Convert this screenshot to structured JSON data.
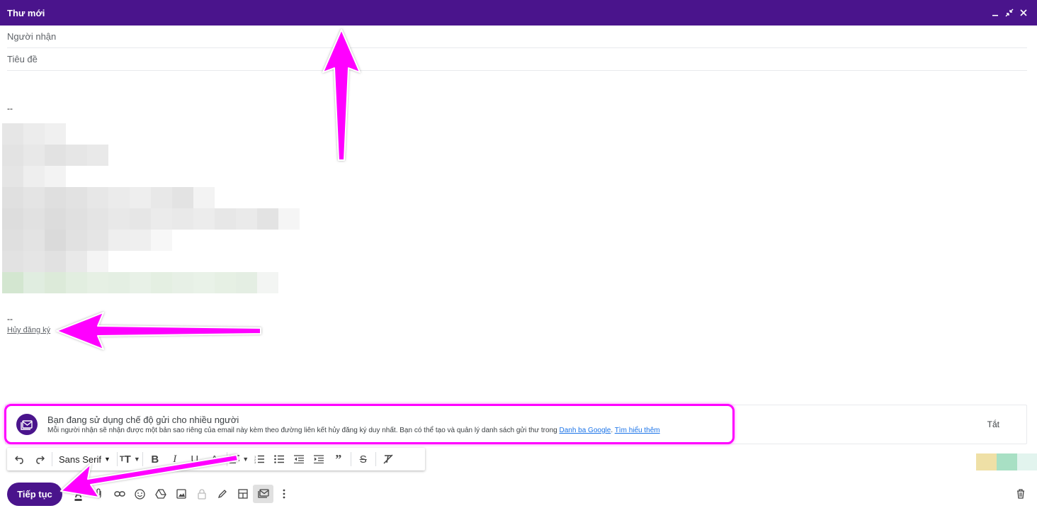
{
  "window": {
    "title": "Thư mới",
    "controls": [
      "minimize-icon",
      "exit-fullscreen-icon",
      "close-icon"
    ]
  },
  "fields": {
    "recipients_placeholder": "Người nhận",
    "subject_placeholder": "Tiêu đề"
  },
  "body": {
    "signature_separator": "--",
    "unsubscribe_label": "Hủy đăng ký"
  },
  "banner": {
    "title": "Bạn đang sử dụng chế độ gửi cho nhiều người",
    "description": "Mỗi người nhận sẽ nhận được một bản sao riêng của email này kèm theo đường liên kết hủy đăng ký duy nhất. Bạn có thể tạo và quản lý danh sách gửi thư trong",
    "link_contacts": "Danh ba Google",
    "separator": ".",
    "link_learn_more": "Tìm hiểu thêm",
    "turn_off_label": "Tắt"
  },
  "format_toolbar": {
    "font_family": "Sans Serif",
    "buttons": [
      "undo-icon",
      "redo-icon",
      "font-size-icon",
      "bold-icon",
      "italic-icon",
      "underline-icon",
      "text-color-icon",
      "align-icon",
      "numbered-list-icon",
      "bulleted-list-icon",
      "indent-less-icon",
      "indent-more-icon",
      "quote-icon",
      "strikethrough-icon",
      "remove-formatting-icon"
    ]
  },
  "bottom_bar": {
    "send_label": "Tiếp tục",
    "icons": [
      "formatting-icon",
      "attach-icon",
      "link-icon",
      "emoji-icon",
      "drive-icon",
      "photo-icon",
      "confidential-icon",
      "signature-icon",
      "layout-icon",
      "multi-send-icon",
      "more-options-icon"
    ],
    "active_icon": "multi-send-icon"
  },
  "colors": {
    "brand": "#4a148c",
    "annotation": "#ff00ff",
    "link": "#1a73e8"
  }
}
